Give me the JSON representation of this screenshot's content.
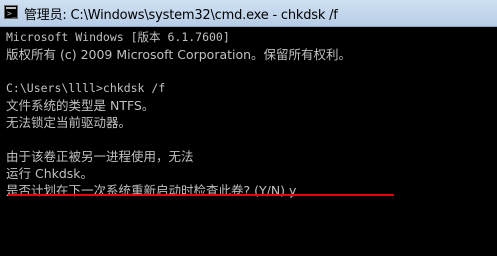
{
  "window": {
    "title": "管理员: C:\\Windows\\system32\\cmd.exe - chkdsk  /f",
    "icon": "cmd-icon"
  },
  "console": {
    "lines": [
      "Microsoft Windows [版本 6.1.7600]",
      "版权所有 (c) 2009 Microsoft Corporation。保留所有权利。",
      "",
      "C:\\Users\\llll>chkdsk /f",
      "文件系统的类型是 NTFS。",
      "无法锁定当前驱动器。",
      "",
      "由于该卷正被另一进程使用，无法",
      "运行 Chkdsk。",
      "是否计划在下一次系统重新启动时检查此卷? (Y/N) y"
    ]
  },
  "colors": {
    "console_bg": "#000000",
    "console_text": "#c0c0c0",
    "highlight_underline": "#e8000c"
  }
}
